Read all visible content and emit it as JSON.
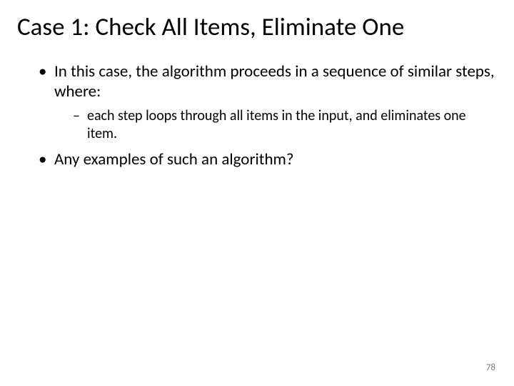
{
  "title": "Case 1: Check All Items, Eliminate One",
  "bullets": {
    "b1": "In this case, the algorithm proceeds in a sequence of similar steps, where:",
    "b1_sub1": "each step loops through all items in the input, and eliminates one item.",
    "b2": "Any examples of such an algorithm?"
  },
  "page_number": "78"
}
